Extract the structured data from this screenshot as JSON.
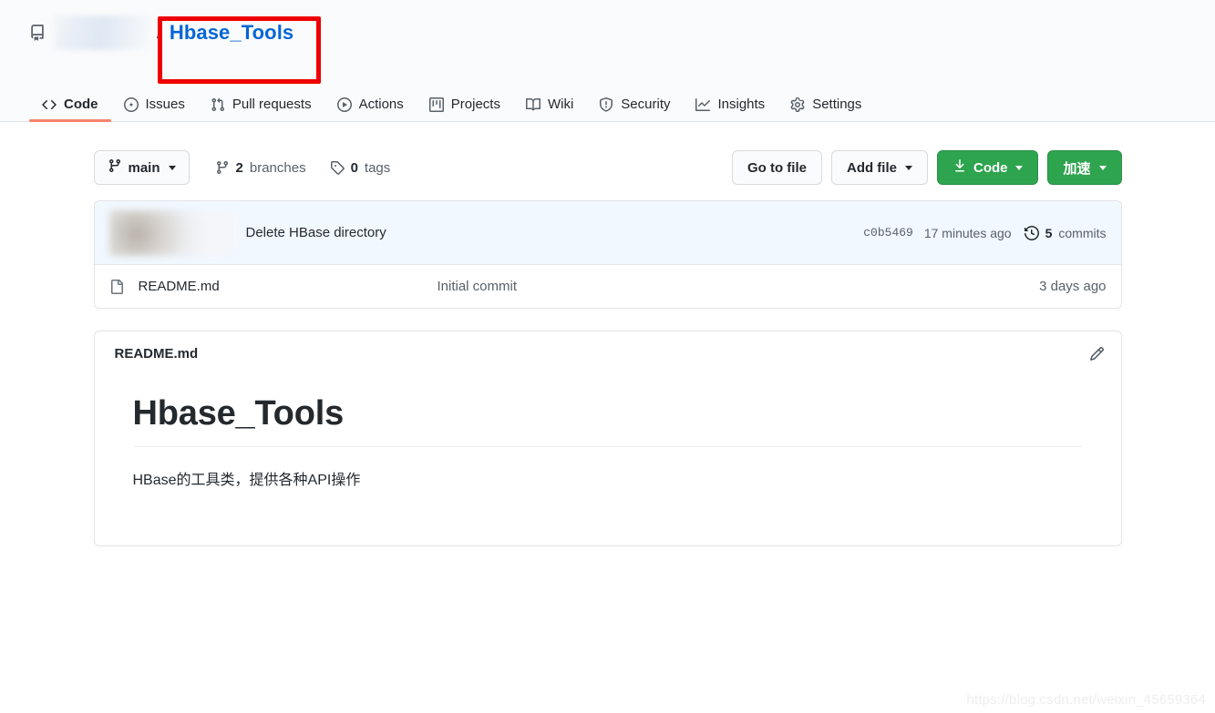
{
  "repo_header": {
    "repo_icon": "repo-icon",
    "owner_name": "",
    "separator": "/",
    "repo_name": "Hbase_Tools",
    "annotation_color": "#ee0000"
  },
  "nav": {
    "active_tab": "Code",
    "active_underline_color": "#f9826c",
    "tabs": [
      {
        "label": "Code",
        "icon": "code-icon"
      },
      {
        "label": "Issues",
        "icon": "issue-opened-icon"
      },
      {
        "label": "Pull requests",
        "icon": "git-pull-request-icon"
      },
      {
        "label": "Actions",
        "icon": "play-circle-icon"
      },
      {
        "label": "Projects",
        "icon": "project-board-icon"
      },
      {
        "label": "Wiki",
        "icon": "book-icon"
      },
      {
        "label": "Security",
        "icon": "shield-icon"
      },
      {
        "label": "Insights",
        "icon": "graph-icon"
      },
      {
        "label": "Settings",
        "icon": "gear-icon"
      }
    ]
  },
  "branch_bar": {
    "branch_name": "main",
    "branch_icon": "git-branch-icon",
    "branches_count": "2",
    "branches_label": "branches",
    "tags_count": "0",
    "tags_label": "tags",
    "tag_icon": "tag-icon",
    "go_to_file_label": "Go to file",
    "add_file_label": "Add file",
    "code_label": "Code",
    "code_icon": "download-icon",
    "accelerate_label": "加速",
    "green_color": "#2ea44f"
  },
  "commit_row": {
    "author_name": "",
    "message": "Delete HBase directory",
    "sha": "c0b5469",
    "time": "17 minutes ago",
    "commits_count": "5",
    "commits_label": "commits",
    "history_icon": "history-icon",
    "background_color": "#f1f8ff"
  },
  "files": [
    {
      "icon": "file-icon",
      "name": "README.md",
      "commit_message": "Initial commit",
      "time": "3 days ago"
    }
  ],
  "readme": {
    "panel_title": "README.md",
    "edit_icon": "pencil-icon",
    "heading": "Hbase_Tools",
    "paragraph": "HBase的工具类，提供各种API操作"
  },
  "watermark": {
    "text": "https://blog.csdn.net/weixin_45659364"
  }
}
